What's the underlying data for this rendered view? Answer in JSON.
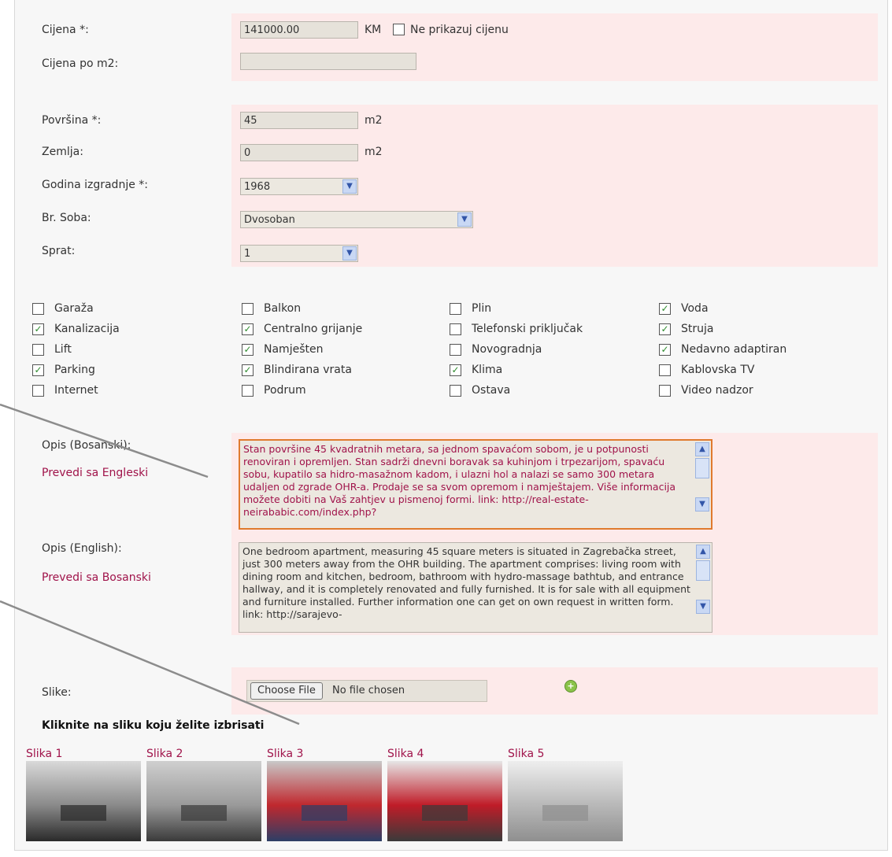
{
  "price": {
    "label": "Cijena *:",
    "value": "141000.00",
    "unit": "KM",
    "hide_label": "Ne prikazuj cijenu"
  },
  "price_m2": {
    "label": "Cijena po m2:",
    "value": ""
  },
  "area": {
    "label": "Površina *:",
    "value": "45",
    "unit": "m2"
  },
  "land": {
    "label": "Zemlja:",
    "value": "0",
    "unit": "m2"
  },
  "year": {
    "label": "Godina izgradnje *:",
    "value": "1968"
  },
  "rooms": {
    "label": "Br. Soba:",
    "value": "Dvosoban"
  },
  "floor": {
    "label": "Sprat:",
    "value": "1"
  },
  "features": [
    {
      "label": "Garaža",
      "checked": false
    },
    {
      "label": "Balkon",
      "checked": false
    },
    {
      "label": "Plin",
      "checked": false
    },
    {
      "label": "Voda",
      "checked": true
    },
    {
      "label": "Kanalizacija",
      "checked": true
    },
    {
      "label": "Centralno grijanje",
      "checked": true
    },
    {
      "label": "Telefonski priključak",
      "checked": false
    },
    {
      "label": "Struja",
      "checked": true
    },
    {
      "label": "Lift",
      "checked": false
    },
    {
      "label": "Namješten",
      "checked": true
    },
    {
      "label": "Novogradnja",
      "checked": false
    },
    {
      "label": "Nedavno adaptiran",
      "checked": true
    },
    {
      "label": "Parking",
      "checked": true
    },
    {
      "label": "Blindirana vrata",
      "checked": true
    },
    {
      "label": "Klima",
      "checked": true
    },
    {
      "label": "Kablovska TV",
      "checked": false
    },
    {
      "label": "Internet",
      "checked": false
    },
    {
      "label": "Podrum",
      "checked": false
    },
    {
      "label": "Ostava",
      "checked": false
    },
    {
      "label": "Video nadzor",
      "checked": false
    }
  ],
  "desc_bs": {
    "label": "Opis (Bosanski):",
    "translate_link": "Prevedi sa Engleski",
    "text": "Stan površine 45 kvadratnih metara, sa jednom spavaćom sobom, je u potpunosti renoviran i opremljen. Stan sadrži dnevni boravak sa kuhinjom i trpezarijom, spavaću sobu, kupatilo sa hidro-masažnom kadom, i ulazni hol a nalazi se samo 300 metara udaljen od zgrade OHR-a. Prodaje se sa svom opremom i namještajem. Više informacija možete dobiti na Vaš zahtjev u pismenoj formi. link: http://real-estate-neirababic.com/index.php?"
  },
  "desc_en": {
    "label": "Opis (English):",
    "translate_link": "Prevedi sa Bosanski",
    "text": "One bedroom apartment, measuring 45 square meters is situated in Zagrebačka street, just 300 meters away from the OHR building. The apartment comprises: living room with dining room and kitchen, bedroom, bathroom with hydro-massage bathtub, and entrance hallway, and it is completely renovated and fully furnished. It is for sale with all equipment and furniture installed. Further information one can get on own request in written form. link: http://sarajevo-"
  },
  "images": {
    "label": "Slike:",
    "choose_button": "Choose File",
    "no_file": "No file chosen",
    "delete_hint": "Kliknite na sliku koju želite izbrisati",
    "items": [
      "Slika 1",
      "Slika 2",
      "Slika 3",
      "Slika 4",
      "Slika 5"
    ]
  },
  "colors": {
    "row_pink": "#fdeaea",
    "link": "#a0134a",
    "check": "#2e8b2e",
    "focus_border": "#e07a2e"
  }
}
